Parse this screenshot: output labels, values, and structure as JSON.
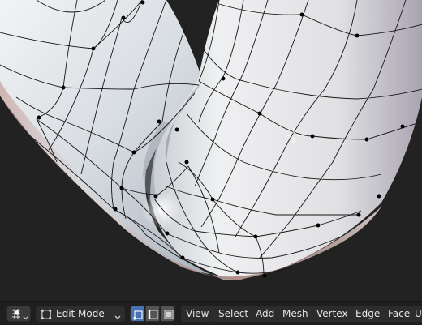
{
  "viewport": {
    "name": "3d-viewport",
    "mesh_color_light": "#e8eaec",
    "mesh_color_shadow": "#c9a9a4",
    "wire_color": "#111111",
    "background": "#222222"
  },
  "header": {
    "transform_pivot_icon": "pivot-icon",
    "mode_select": {
      "value": "Edit Mode",
      "icon": "edit-mode-icon"
    },
    "select_modes": {
      "vertex": "vertex-select-icon",
      "edge": "edge-select-icon",
      "face": "face-select-icon",
      "active": "vertex",
      "accent": "#4772b3"
    },
    "menus": [
      "View",
      "Select",
      "Add",
      "Mesh",
      "Vertex",
      "Edge",
      "Face",
      "U"
    ]
  }
}
